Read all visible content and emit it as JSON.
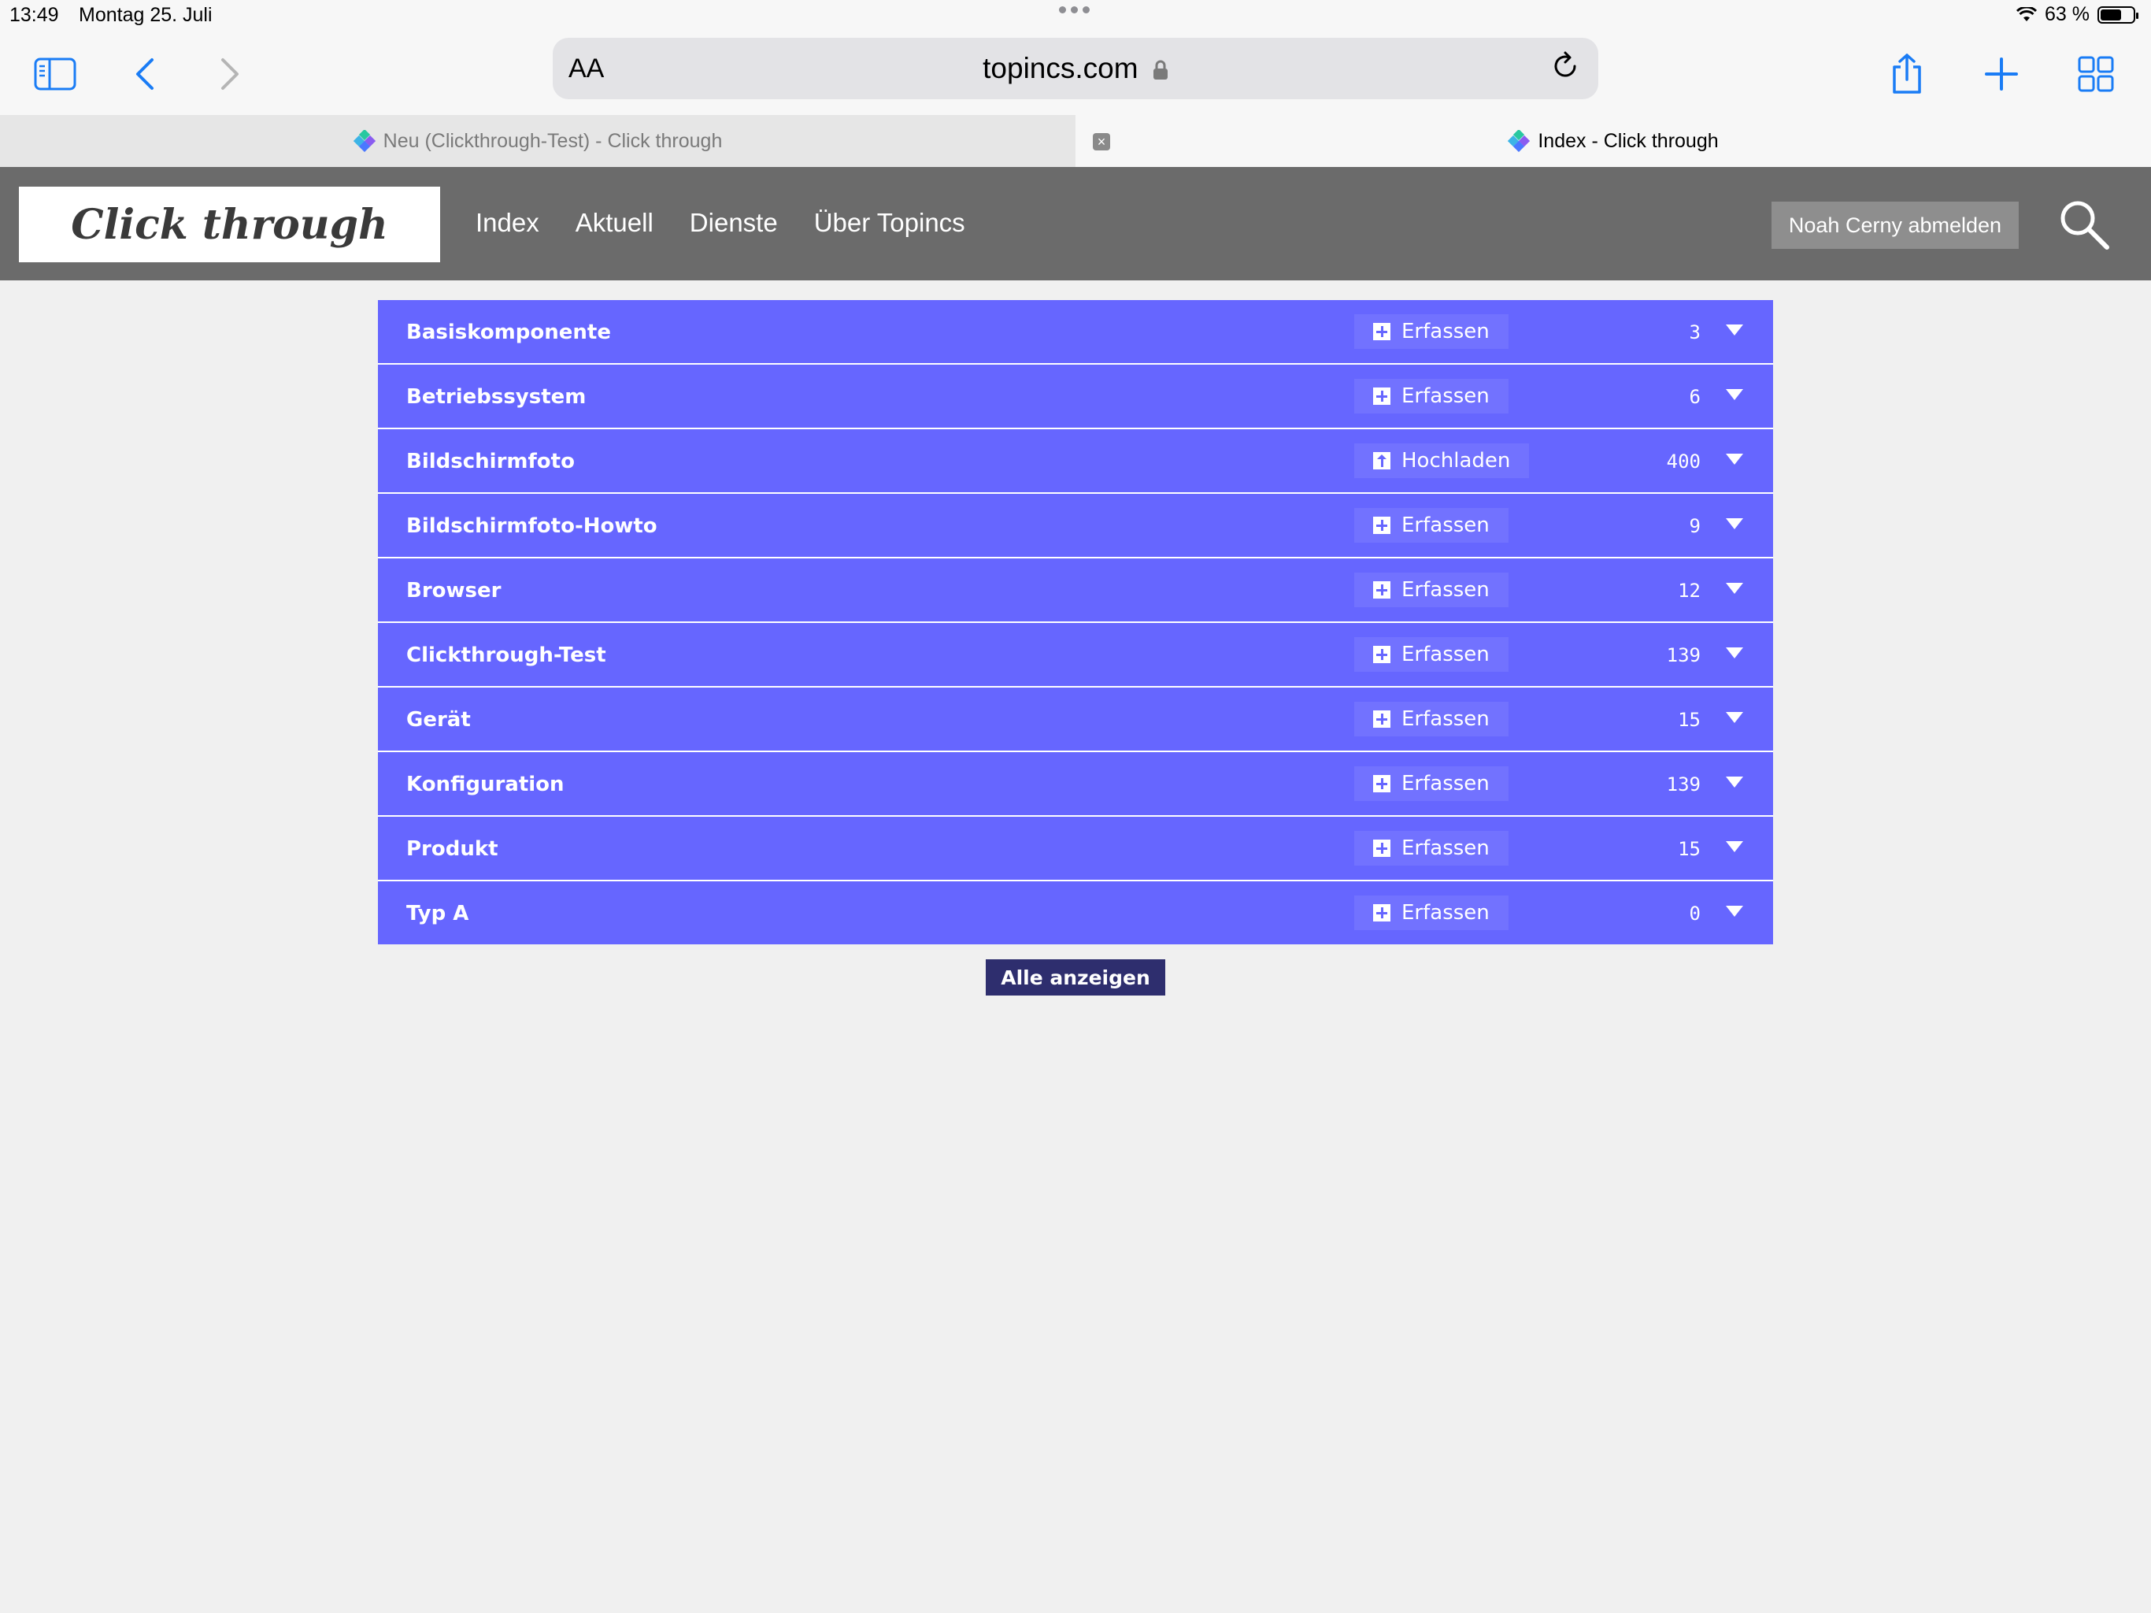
{
  "status": {
    "time": "13:49",
    "date": "Montag 25. Juli",
    "battery": "63 %"
  },
  "browser": {
    "aa_label": "AA",
    "url": "topincs.com",
    "tabs": [
      {
        "title": "Neu (Clickthrough-Test) - Click through",
        "active": false
      },
      {
        "title": "Index - Click through",
        "active": true
      }
    ],
    "accent_color": "#1a7cf5"
  },
  "site": {
    "logo": "Click through",
    "nav": [
      "Index",
      "Aktuell",
      "Dienste",
      "Über Topincs"
    ],
    "logout_label": "Noah Cerny abmelden"
  },
  "list": {
    "row_color": "#6666ff",
    "rows": [
      {
        "label": "Basiskomponente",
        "action": "Erfassen",
        "action_icon": "plus-icon",
        "count": "3"
      },
      {
        "label": "Betriebssystem",
        "action": "Erfassen",
        "action_icon": "plus-icon",
        "count": "6"
      },
      {
        "label": "Bildschirmfoto",
        "action": "Hochladen",
        "action_icon": "upload-icon",
        "count": "400"
      },
      {
        "label": "Bildschirmfoto-Howto",
        "action": "Erfassen",
        "action_icon": "plus-icon",
        "count": "9"
      },
      {
        "label": "Browser",
        "action": "Erfassen",
        "action_icon": "plus-icon",
        "count": "12"
      },
      {
        "label": "Clickthrough-Test",
        "action": "Erfassen",
        "action_icon": "plus-icon",
        "count": "139"
      },
      {
        "label": "Gerät",
        "action": "Erfassen",
        "action_icon": "plus-icon",
        "count": "15"
      },
      {
        "label": "Konfiguration",
        "action": "Erfassen",
        "action_icon": "plus-icon",
        "count": "139"
      },
      {
        "label": "Produkt",
        "action": "Erfassen",
        "action_icon": "plus-icon",
        "count": "15"
      },
      {
        "label": "Typ A",
        "action": "Erfassen",
        "action_icon": "plus-icon",
        "count": "0"
      }
    ],
    "show_all_label": "Alle anzeigen"
  }
}
